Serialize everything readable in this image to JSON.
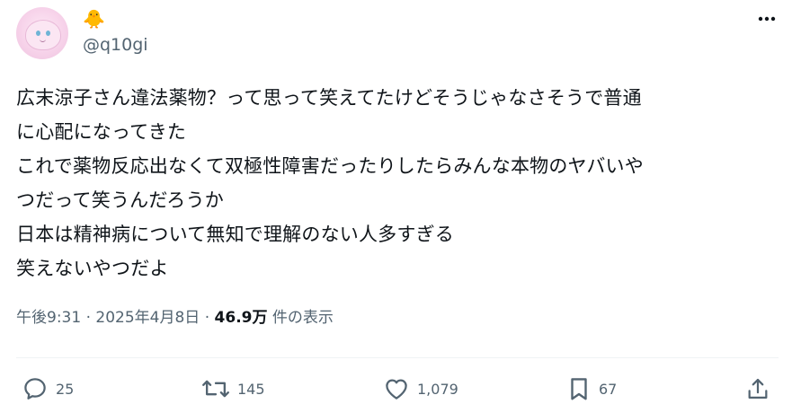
{
  "author": {
    "display_emoji": "🐥",
    "handle": "@q10gi"
  },
  "tweet": {
    "lines": [
      "広末涼子さん違法薬物？って思って笑えてたけどそうじゃなさそうで普通",
      "に心配になってきた",
      "これで薬物反応出なくて双極性障害だったりしたらみんな本物のヤバいや",
      "つだって笑うんだろうか",
      "日本は精神病について無知で理解のない人多すぎる",
      "笑えないやつだよ"
    ],
    "time": "午後9:31",
    "separator": "·",
    "date": "2025年4月8日",
    "views_count": "46.9万",
    "views_label": "件の表示"
  },
  "actions": {
    "replies": "25",
    "retweets": "145",
    "likes": "1,079",
    "bookmarks": "67"
  },
  "colors": {
    "text": "#0f1419",
    "secondary": "#536471",
    "divider": "#eff3f4"
  }
}
